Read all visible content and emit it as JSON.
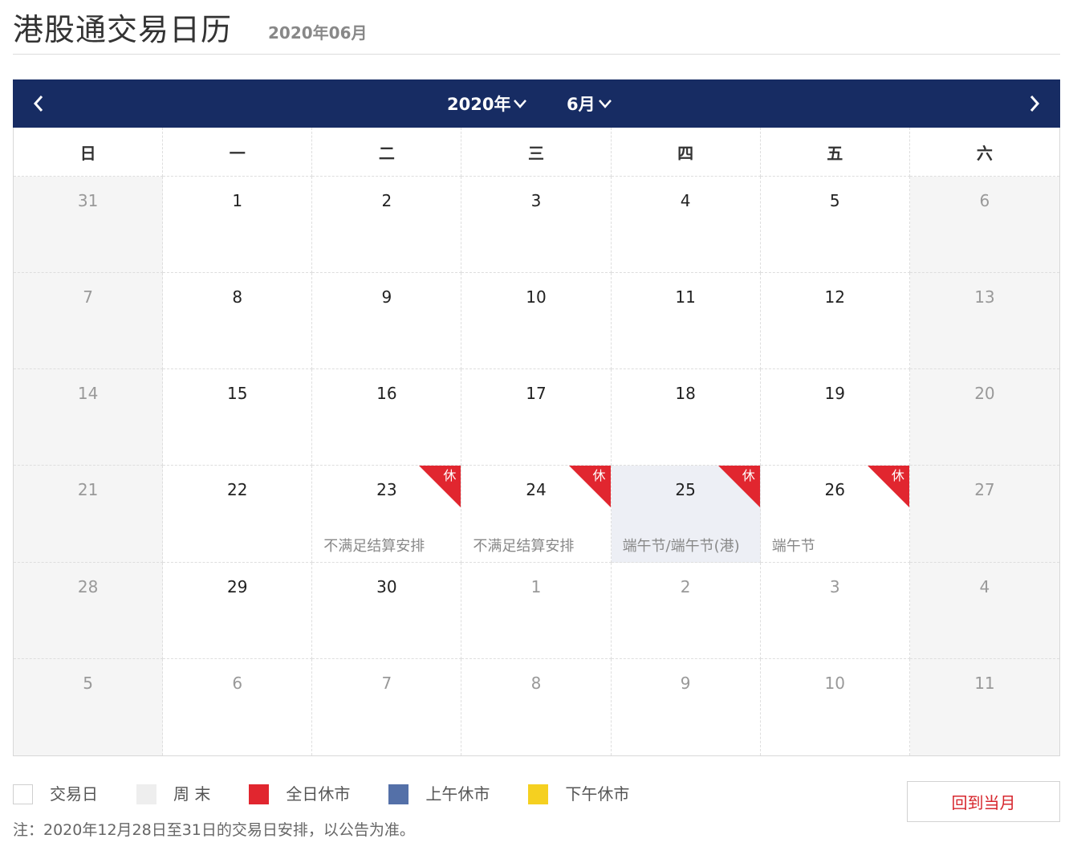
{
  "page": {
    "title": "港股通交易日历",
    "subtitle": "2020年06月"
  },
  "calendar": {
    "year_label": "2020年",
    "month_label": "6月",
    "weekdays": [
      "日",
      "一",
      "二",
      "三",
      "四",
      "五",
      "六"
    ],
    "rest_badge": "休",
    "days": [
      {
        "num": "31",
        "other": true,
        "weekend": true
      },
      {
        "num": "1"
      },
      {
        "num": "2"
      },
      {
        "num": "3"
      },
      {
        "num": "4"
      },
      {
        "num": "5"
      },
      {
        "num": "6",
        "weekend": true
      },
      {
        "num": "7",
        "weekend": true
      },
      {
        "num": "8"
      },
      {
        "num": "9"
      },
      {
        "num": "10"
      },
      {
        "num": "11"
      },
      {
        "num": "12"
      },
      {
        "num": "13",
        "weekend": true
      },
      {
        "num": "14",
        "weekend": true
      },
      {
        "num": "15"
      },
      {
        "num": "16"
      },
      {
        "num": "17"
      },
      {
        "num": "18"
      },
      {
        "num": "19"
      },
      {
        "num": "20",
        "weekend": true
      },
      {
        "num": "21",
        "weekend": true
      },
      {
        "num": "22"
      },
      {
        "num": "23",
        "rest": true,
        "note": "不满足结算安排"
      },
      {
        "num": "24",
        "rest": true,
        "note": "不满足结算安排"
      },
      {
        "num": "25",
        "rest": true,
        "today": true,
        "note": "端午节/端午节(港)"
      },
      {
        "num": "26",
        "rest": true,
        "note": "端午节"
      },
      {
        "num": "27",
        "weekend": true
      },
      {
        "num": "28",
        "weekend": true
      },
      {
        "num": "29"
      },
      {
        "num": "30"
      },
      {
        "num": "1",
        "other": true
      },
      {
        "num": "2",
        "other": true
      },
      {
        "num": "3",
        "other": true
      },
      {
        "num": "4",
        "other": true,
        "weekend": true
      },
      {
        "num": "5",
        "other": true,
        "weekend": true
      },
      {
        "num": "6",
        "other": true
      },
      {
        "num": "7",
        "other": true
      },
      {
        "num": "8",
        "other": true
      },
      {
        "num": "9",
        "other": true
      },
      {
        "num": "10",
        "other": true
      },
      {
        "num": "11",
        "other": true,
        "weekend": true
      }
    ]
  },
  "legend": {
    "items": [
      {
        "key": "trading",
        "label": "交易日",
        "color": "#ffffff"
      },
      {
        "key": "weekend",
        "label": "周 末",
        "color": "#eeeeee"
      },
      {
        "key": "full-closed",
        "label": "全日休市",
        "color": "#e1262f"
      },
      {
        "key": "am-closed",
        "label": "上午休市",
        "color": "#5470a8"
      },
      {
        "key": "pm-closed",
        "label": "下午休市",
        "color": "#f5d020"
      }
    ]
  },
  "note": "注：2020年12月28日至31日的交易日安排，以公告为准。",
  "back_button": "回到当月",
  "colors": {
    "header_bg": "#172c63",
    "rest_red": "#e1262f",
    "today_bg": "#edeff5",
    "weekend_bg": "#f5f5f5"
  }
}
